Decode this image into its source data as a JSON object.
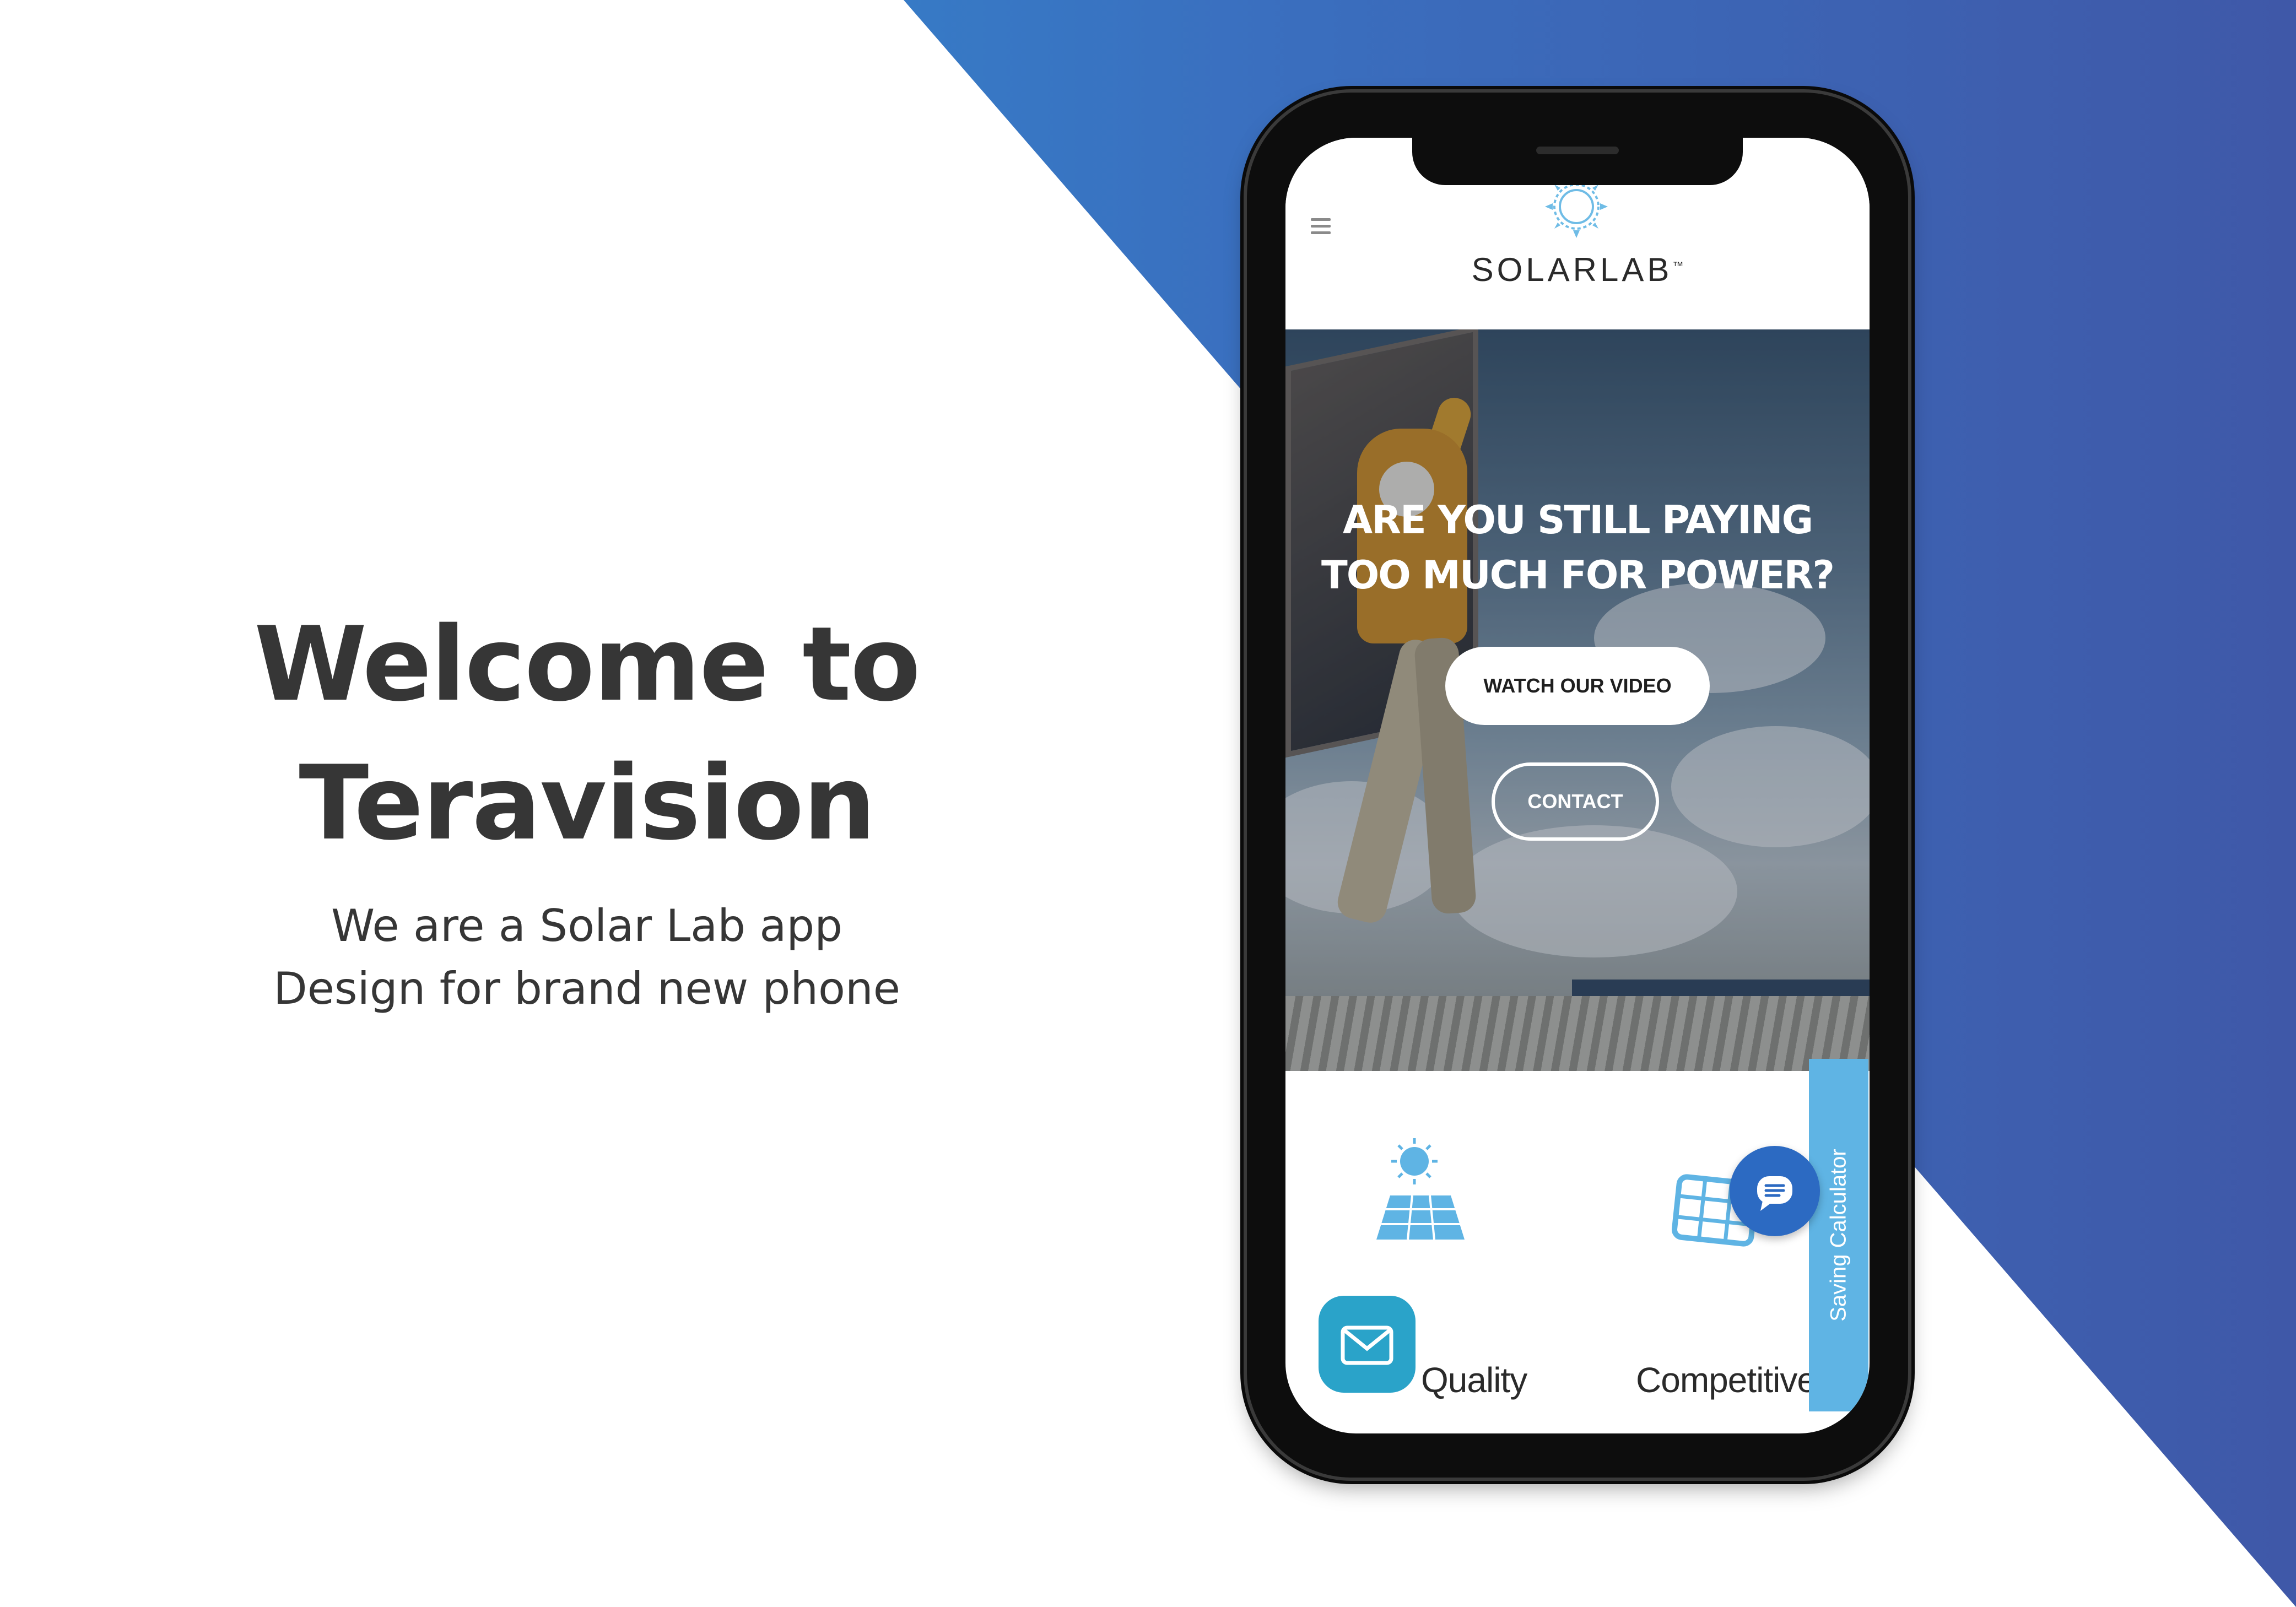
{
  "intro": {
    "title_line1": "Welcome to",
    "title_line2": "Teravision",
    "subtitle_line1": "We are a Solar Lab app",
    "subtitle_line2": "Design for brand new phone"
  },
  "app": {
    "brand": "SOLARLAB",
    "brand_mark": "™",
    "hero": {
      "title_line1": "ARE YOU STILL PAYING",
      "title_line2": "TOO MUCH FOR POWER?",
      "watch_video_label": "WATCH OUR VIDEO",
      "contact_label": "CONTACT"
    },
    "saving_calculator_label": "Saving Calculator",
    "features": [
      {
        "label": "Quality",
        "icon": "solar-farm-icon"
      },
      {
        "label": "Competitive",
        "icon": "solar-panel-icon"
      }
    ],
    "chat_icon": "chat-icon",
    "mail_icon": "mail-icon",
    "menu_icon": "hamburger-menu-icon"
  },
  "colors": {
    "gradient_start": "#2f95d6",
    "gradient_end": "#3f58a8",
    "accent_light_blue": "#5fb4e4",
    "chat_button": "#2c6ac2",
    "mail_button": "#2aa3c9",
    "heading_text": "#363636"
  }
}
